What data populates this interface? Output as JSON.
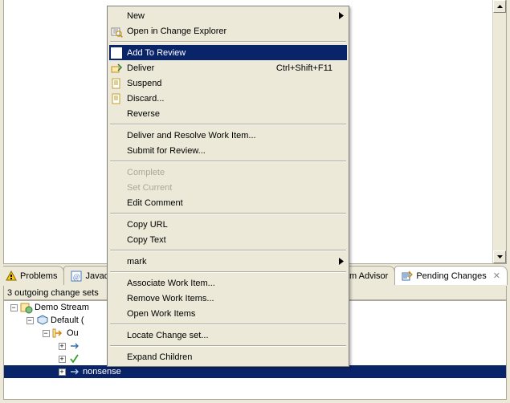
{
  "tabs": [
    {
      "label": "Problems",
      "active": false,
      "clipped": true
    },
    {
      "label": "Javado",
      "active": false,
      "clipped": false
    },
    {
      "label": "Team Advisor",
      "active": false,
      "clipped": true
    },
    {
      "label": "Pending Changes",
      "active": true,
      "clipped": false
    }
  ],
  "status": {
    "text": "3 outgoing change sets"
  },
  "tree": {
    "n0": {
      "label": "Demo Stream"
    },
    "n1": {
      "label": "Default ("
    },
    "n2": {
      "label": "Ou"
    },
    "n3": {
      "label": ""
    },
    "n4": {
      "label": ""
    },
    "n5": {
      "label": "nonsense"
    }
  },
  "menu": [
    {
      "id": "new",
      "label": "New",
      "icon": "",
      "sub": true
    },
    {
      "id": "open-change",
      "label": "Open in Change Explorer",
      "icon": "open-change"
    },
    {
      "sep": true
    },
    {
      "id": "add-review",
      "label": "Add To Review",
      "icon": "check",
      "hi": true
    },
    {
      "id": "deliver",
      "label": "Deliver",
      "icon": "deliver",
      "accel": "Ctrl+Shift+F11"
    },
    {
      "id": "suspend",
      "label": "Suspend",
      "icon": "doc"
    },
    {
      "id": "discard",
      "label": "Discard...",
      "icon": "doc"
    },
    {
      "id": "reverse",
      "label": "Reverse"
    },
    {
      "sep": true
    },
    {
      "id": "deliver-resolve",
      "label": "Deliver and Resolve Work Item..."
    },
    {
      "id": "submit-review",
      "label": "Submit for Review..."
    },
    {
      "sep": true
    },
    {
      "id": "complete",
      "label": "Complete",
      "disabled": true
    },
    {
      "id": "set-current",
      "label": "Set Current",
      "disabled": true
    },
    {
      "id": "edit-comment",
      "label": "Edit Comment"
    },
    {
      "sep": true
    },
    {
      "id": "copy-url",
      "label": "Copy URL"
    },
    {
      "id": "copy-text",
      "label": "Copy Text"
    },
    {
      "sep": true
    },
    {
      "id": "mark",
      "label": "mark",
      "sub": true
    },
    {
      "sep": true
    },
    {
      "id": "associate",
      "label": "Associate Work Item..."
    },
    {
      "id": "remove-wi",
      "label": "Remove Work Items..."
    },
    {
      "id": "open-wi",
      "label": "Open Work Items"
    },
    {
      "sep": true
    },
    {
      "id": "locate",
      "label": "Locate Change set..."
    },
    {
      "sep": true
    },
    {
      "id": "expand",
      "label": "Expand Children"
    }
  ]
}
